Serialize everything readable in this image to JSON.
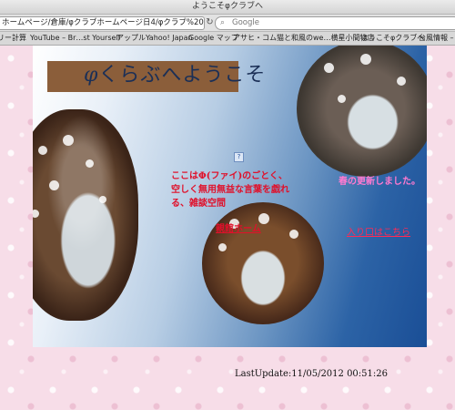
{
  "window": {
    "title": "ようこそφクラブへ"
  },
  "address_bar": {
    "url": "ホームページ/倉庫/φクラブホームページ日4/φクラブ%20folder/…",
    "search_placeholder": "Google"
  },
  "bookmarks": [
    "リー計算",
    "YouTube – Br…st Yourself",
    "アップル",
    "Yahoo! Japan",
    "Google マップ",
    "アサヒ・コム",
    "猫と和風のwe…横星小間物店",
    "ようこそφクラブへ",
    "台風情報 – ウ"
  ],
  "page": {
    "title_phi": "φ",
    "title_rest": "くらぶへようこ",
    "title_end": "そ",
    "broken_image_glyph": "?",
    "intro": "ここはΦ(ファイ)のごとく、空しく無用無益な言葉を戯れる、雑談空間",
    "master_link": "親館ホーム",
    "spring_note": "春の更新しました。",
    "enter_link": "入り口はこちら",
    "last_update": "LastUpdate:11/05/2012 00:51:26"
  },
  "colors": {
    "page_background": "#f7dde8",
    "title_box": "#8b5e3a",
    "intro_text": "#e0102a",
    "spring_note": "#ff7ad0",
    "enter_link": "#ff2a55"
  }
}
